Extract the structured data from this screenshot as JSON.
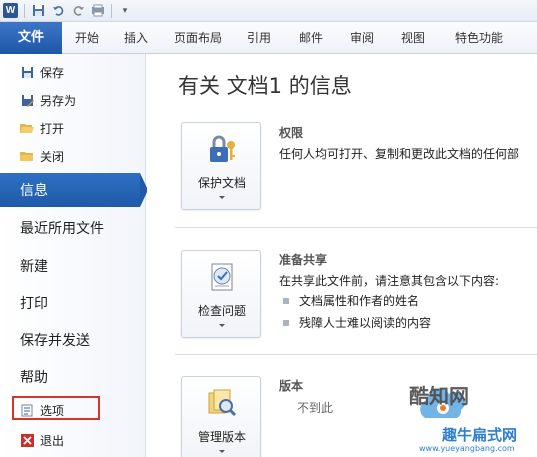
{
  "ribbon": {
    "file_tab": "文件",
    "tabs": [
      "开始",
      "插入",
      "页面布局",
      "引用",
      "邮件",
      "审阅",
      "视图",
      "特色功能"
    ]
  },
  "nav": {
    "save": "保存",
    "save_as": "另存为",
    "open": "打开",
    "close": "关闭",
    "info": "信息",
    "recent": "最近所用文件",
    "new": "新建",
    "print": "打印",
    "save_send": "保存并发送",
    "help": "帮助",
    "options": "选项",
    "exit": "退出"
  },
  "main": {
    "title": "有关 文档1 的信息",
    "permissions": {
      "button": "保护文档",
      "title": "权限",
      "desc": "任何人均可打开、复制和更改此文档的任何部"
    },
    "share": {
      "button": "检查问题",
      "title": "准备共享",
      "desc": "在共享此文件前，请注意其包含以下内容:",
      "items": [
        "文档属性和作者的姓名",
        "残障人士难以阅读的内容"
      ]
    },
    "versions": {
      "button": "管理版本",
      "title": "版本",
      "partial": "不到此"
    }
  },
  "watermark": {
    "brand": "酷知网",
    "site": "趣牛扁式网",
    "url": "www.yueyangbang.com"
  },
  "colors": {
    "accent": "#1e5aa8",
    "highlight_box": "#d9342b"
  }
}
